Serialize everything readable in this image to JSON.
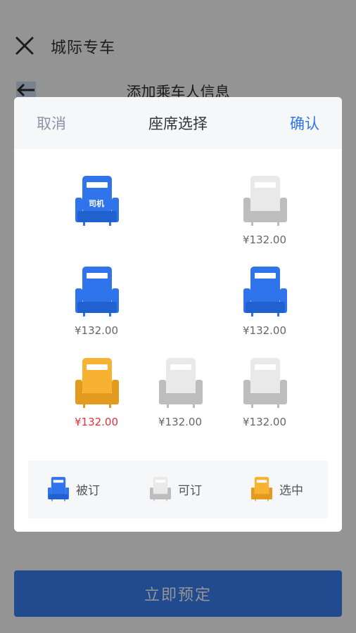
{
  "app_title": "城际专车",
  "page_title": "添加乘车人信息",
  "book_button": "立即预定",
  "sheet": {
    "cancel": "取消",
    "title": "座席选择",
    "confirm": "确认"
  },
  "seats": {
    "driver_label": "司机",
    "front_right": {
      "price": "¥132.00",
      "status": "available"
    },
    "middle_left": {
      "price": "¥132.00",
      "status": "booked"
    },
    "middle_right": {
      "price": "¥132.00",
      "status": "booked"
    },
    "rear_left": {
      "price": "¥132.00",
      "status": "selected"
    },
    "rear_middle": {
      "price": "¥132.00",
      "status": "available"
    },
    "rear_right": {
      "price": "¥132.00",
      "status": "available"
    }
  },
  "legend": {
    "booked": "被订",
    "available": "可订",
    "selected": "选中"
  },
  "colors": {
    "booked": "#2f74ea",
    "available": "#e9e9e9",
    "selected": "#f5ae2b",
    "accent": "#2f74ea",
    "price_selected": "#e0323c"
  },
  "icons": [
    "close-icon",
    "back-arrow-icon",
    "seat-icon"
  ]
}
